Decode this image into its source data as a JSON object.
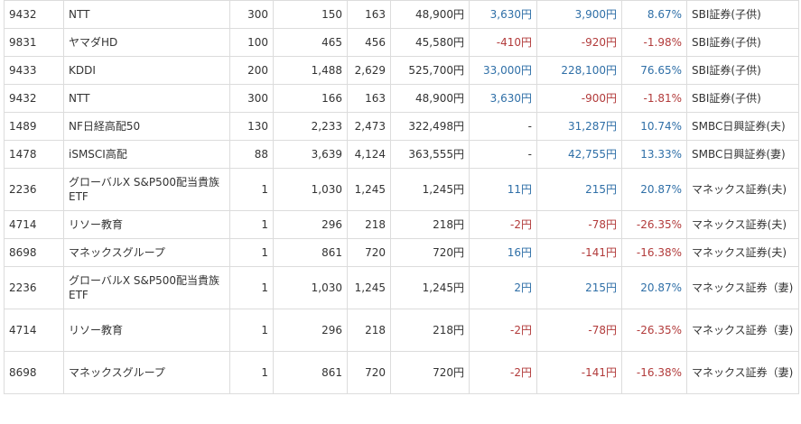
{
  "rows": [
    {
      "code": "9432",
      "name": "NTT",
      "qty": "300",
      "buy": "150",
      "now": "163",
      "value": "48,900円",
      "dividend": "3,630円",
      "dividend_c": "pos",
      "profit": "3,900円",
      "profit_c": "pos",
      "rate": "8.67%",
      "rate_c": "pos",
      "broker": "SBI証券(子供)",
      "tall": false
    },
    {
      "code": "9831",
      "name": "ヤマダHD",
      "qty": "100",
      "buy": "465",
      "now": "456",
      "value": "45,580円",
      "dividend": "-410円",
      "dividend_c": "neg",
      "profit": "-920円",
      "profit_c": "neg",
      "rate": "-1.98%",
      "rate_c": "neg",
      "broker": "SBI証券(子供)",
      "tall": false
    },
    {
      "code": "9433",
      "name": "KDDI",
      "qty": "200",
      "buy": "1,488",
      "now": "2,629",
      "value": "525,700円",
      "dividend": "33,000円",
      "dividend_c": "pos",
      "profit": "228,100円",
      "profit_c": "pos",
      "rate": "76.65%",
      "rate_c": "pos",
      "broker": "SBI証券(子供)",
      "tall": false
    },
    {
      "code": "9432",
      "name": "NTT",
      "qty": "300",
      "buy": "166",
      "now": "163",
      "value": "48,900円",
      "dividend": "3,630円",
      "dividend_c": "pos",
      "profit": "-900円",
      "profit_c": "neg",
      "rate": "-1.81%",
      "rate_c": "neg",
      "broker": "SBI証券(子供)",
      "tall": false
    },
    {
      "code": "1489",
      "name": "NF日経高配50",
      "qty": "130",
      "buy": "2,233",
      "now": "2,473",
      "value": "322,498円",
      "dividend": "-",
      "dividend_c": "neu",
      "profit": "31,287円",
      "profit_c": "pos",
      "rate": "10.74%",
      "rate_c": "pos",
      "broker": "SMBC日興証券(夫)",
      "tall": false
    },
    {
      "code": "1478",
      "name": "iSMSCI高配",
      "qty": "88",
      "buy": "3,639",
      "now": "4,124",
      "value": "363,555円",
      "dividend": "-",
      "dividend_c": "neu",
      "profit": "42,755円",
      "profit_c": "pos",
      "rate": "13.33%",
      "rate_c": "pos",
      "broker": "SMBC日興証券(妻)",
      "tall": false
    },
    {
      "code": "2236",
      "name": "グローバルX S&P500配当貴族ETF",
      "qty": "1",
      "buy": "1,030",
      "now": "1,245",
      "value": "1,245円",
      "dividend": "11円",
      "dividend_c": "pos",
      "profit": "215円",
      "profit_c": "pos",
      "rate": "20.87%",
      "rate_c": "pos",
      "broker": "マネックス証券(夫)",
      "tall": true
    },
    {
      "code": "4714",
      "name": "リソー教育",
      "qty": "1",
      "buy": "296",
      "now": "218",
      "value": "218円",
      "dividend": "-2円",
      "dividend_c": "neg",
      "profit": "-78円",
      "profit_c": "neg",
      "rate": "-26.35%",
      "rate_c": "neg",
      "broker": "マネックス証券(夫)",
      "tall": false
    },
    {
      "code": "8698",
      "name": "マネックスグループ",
      "qty": "1",
      "buy": "861",
      "now": "720",
      "value": "720円",
      "dividend": "16円",
      "dividend_c": "pos",
      "profit": "-141円",
      "profit_c": "neg",
      "rate": "-16.38%",
      "rate_c": "neg",
      "broker": "マネックス証券(夫)",
      "tall": false
    },
    {
      "code": "2236",
      "name": "グローバルX S&P500配当貴族ETF",
      "qty": "1",
      "buy": "1,030",
      "now": "1,245",
      "value": "1,245円",
      "dividend": "2円",
      "dividend_c": "pos",
      "profit": "215円",
      "profit_c": "pos",
      "rate": "20.87%",
      "rate_c": "pos",
      "broker": "マネックス証券（妻)",
      "tall": true
    },
    {
      "code": "4714",
      "name": "リソー教育",
      "qty": "1",
      "buy": "296",
      "now": "218",
      "value": "218円",
      "dividend": "-2円",
      "dividend_c": "neg",
      "profit": "-78円",
      "profit_c": "neg",
      "rate": "-26.35%",
      "rate_c": "neg",
      "broker": "マネックス証券（妻)",
      "tall": true
    },
    {
      "code": "8698",
      "name": "マネックスグループ",
      "qty": "1",
      "buy": "861",
      "now": "720",
      "value": "720円",
      "dividend": "-2円",
      "dividend_c": "neg",
      "profit": "-141円",
      "profit_c": "neg",
      "rate": "-16.38%",
      "rate_c": "neg",
      "broker": "マネックス証券（妻)",
      "tall": true
    }
  ],
  "colors": {
    "positive": "#2f6fa7",
    "negative": "#b23b3b",
    "border": "#dcdcdc"
  }
}
